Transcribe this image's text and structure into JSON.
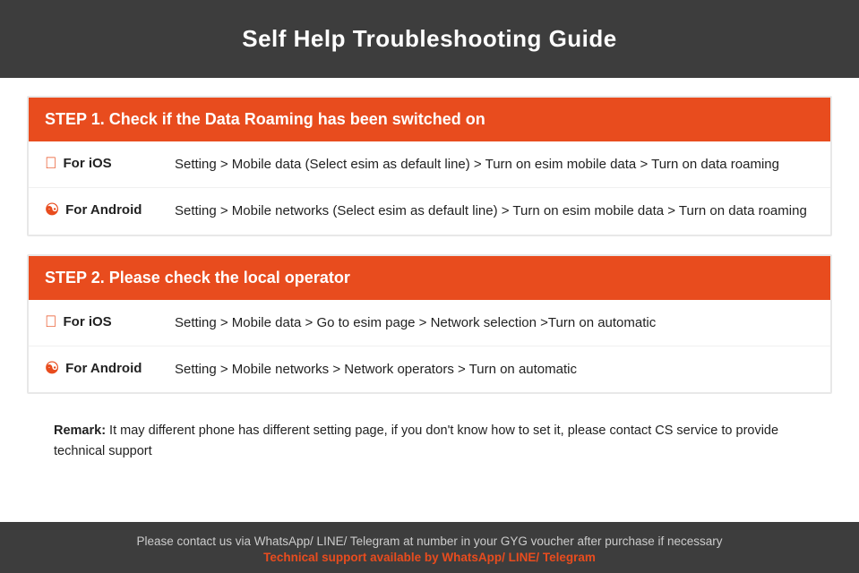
{
  "header": {
    "title": "Self Help Troubleshooting Guide"
  },
  "step1": {
    "heading": "STEP 1.  Check if the Data Roaming has been switched on",
    "ios_label": "For iOS",
    "ios_text": "Setting > Mobile data (Select esim as default line) > Turn on esim mobile data > Turn on data roaming",
    "android_label": "For Android",
    "android_text": "Setting > Mobile networks (Select esim as default line) > Turn on esim mobile data > Turn on data roaming"
  },
  "step2": {
    "heading": "STEP 2.  Please check the local operator",
    "ios_label": "For iOS",
    "ios_text": "Setting > Mobile data > Go to esim page > Network selection >Turn on automatic",
    "android_label": "For Android",
    "android_text": "Setting > Mobile networks > Network operators > Turn on automatic"
  },
  "remark": {
    "label": "Remark:",
    "text": " It may different phone has different setting page, if you don't know how to set it,  please contact CS service to provide technical support"
  },
  "footer": {
    "contact_text": "Please contact us via WhatsApp/ LINE/ Telegram at number in your GYG voucher after purchase if necessary",
    "support_text": "Technical support available by WhatsApp/ LINE/ Telegram"
  }
}
